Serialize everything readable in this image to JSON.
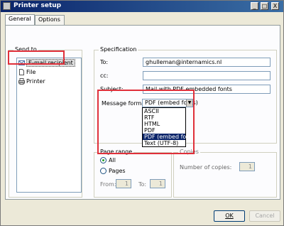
{
  "window": {
    "title": "Printer setup"
  },
  "titlebar": {
    "minimize": "_",
    "maximize": "□",
    "close": "X"
  },
  "tabs": [
    {
      "label": "General"
    },
    {
      "label": "Options"
    }
  ],
  "send_to": {
    "label": "Send to",
    "items": [
      {
        "label": "E-mail recipient",
        "icon": "email-recipient-icon"
      },
      {
        "label": "File",
        "icon": "file-icon"
      },
      {
        "label": "Printer",
        "icon": "printer-icon"
      }
    ]
  },
  "specification": {
    "label": "Specification",
    "to_label": "To:",
    "to_value": "ghulleman@internamics.nl",
    "cc_label": "cc:",
    "cc_value": "",
    "subject_label": "Subject:",
    "subject_value": "Mail with PDF embedded fonts",
    "format_label": "Message format:",
    "format_value": "PDF (embed fonts)",
    "format_options": [
      "ASCII",
      "RTF",
      "HTML",
      "PDF",
      "PDF (embed fonts)",
      "Text (UTF-8)"
    ]
  },
  "page_range": {
    "label": "Page range",
    "all_label": "All",
    "pages_label": "Pages",
    "from_label": "From:",
    "from_value": "1",
    "to_label": "To:",
    "to_value": "1"
  },
  "copies": {
    "label": "Copies",
    "number_label": "Number of copies:",
    "number_value": "1"
  },
  "buttons": {
    "ok": "OK",
    "cancel": "Cancel"
  },
  "colors": {
    "highlight": "#e0303a",
    "selected_option": "#0a246a"
  }
}
